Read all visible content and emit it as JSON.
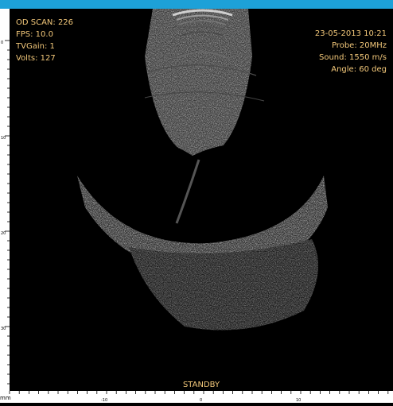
{
  "scan_info": {
    "od_scan": "OD SCAN: 226",
    "fps": "FPS: 10.0",
    "tvgain": "TVGain: 1",
    "volts": "Volts: 127"
  },
  "probe_info": {
    "datetime": "23-05-2013 10:21",
    "probe": "Probe: 20MHz",
    "sound": "Sound: 1550 m/s",
    "angle": "Angle: 60 deg"
  },
  "status": "STANDBY",
  "ruler": {
    "unit": "mm",
    "vertical_labels": [
      "0",
      "10",
      "20",
      "30"
    ],
    "horizontal_labels": [
      "-10",
      "0",
      "10"
    ]
  },
  "colors": {
    "accent_bar": "#1da1d8",
    "overlay_text": "#f3c87a"
  }
}
